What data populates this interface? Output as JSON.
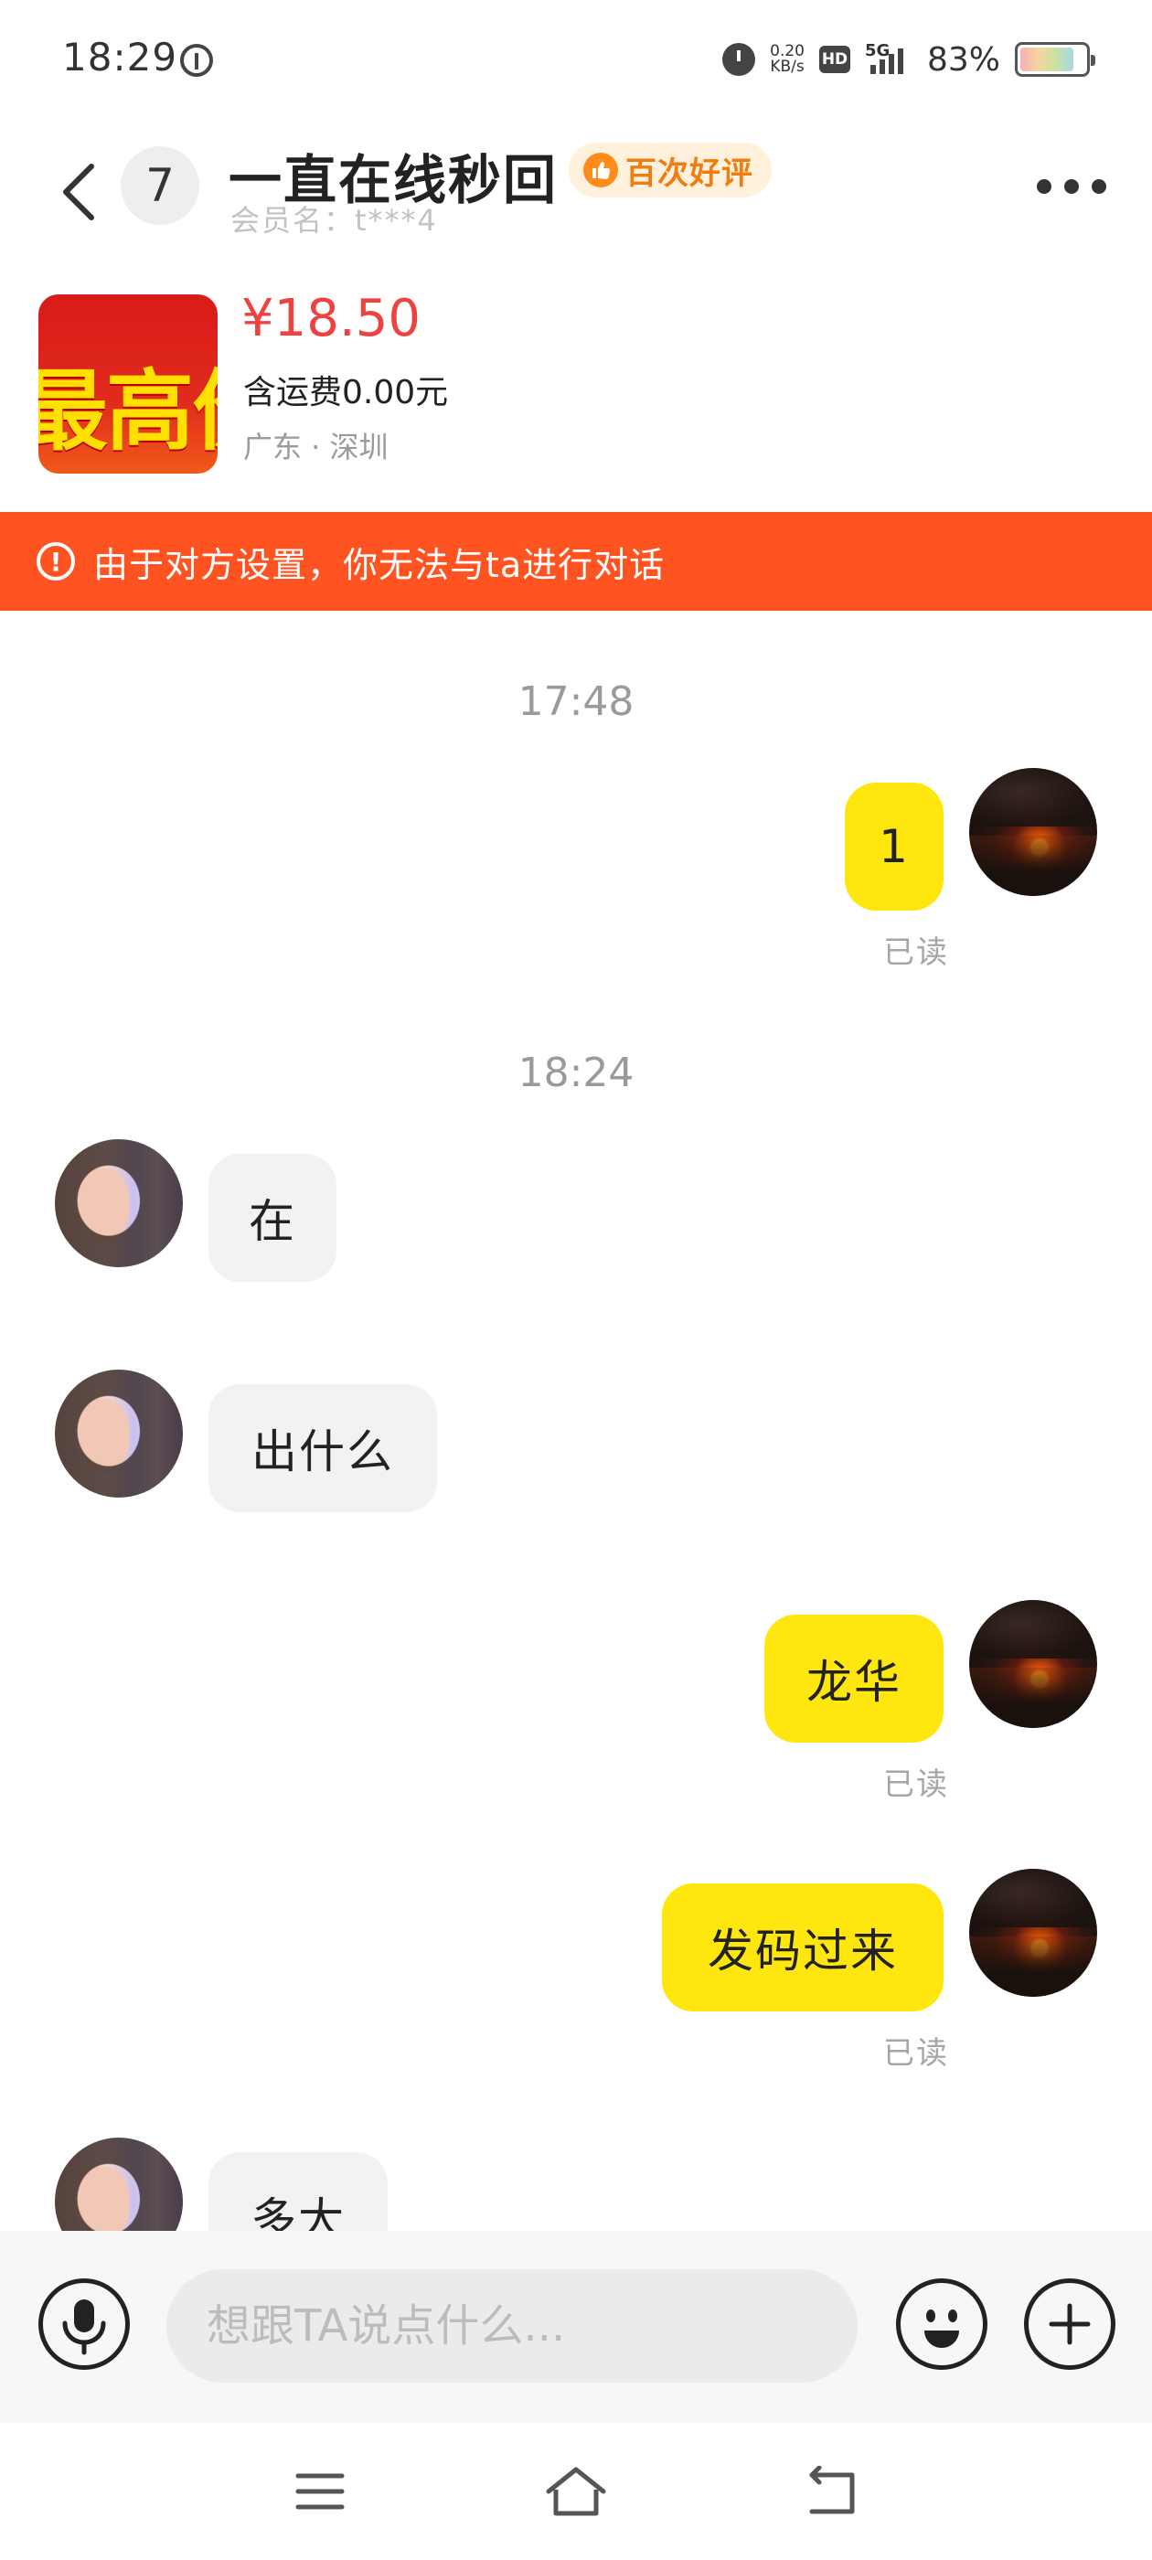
{
  "status_bar": {
    "time": "18:29",
    "net_speed_value": "0.20",
    "net_speed_unit": "KB/s",
    "hd_label": "HD",
    "network_type": "5G",
    "battery_percent": "83%",
    "battery_level": 0.83
  },
  "header": {
    "unread_count": "7",
    "shop_name": "一直在线秒回",
    "rating_badge": "百次好评",
    "member_name": "会员名：t***4"
  },
  "product": {
    "image_text": "最高价",
    "price": "¥18.50",
    "shipping": "含运费0.00元",
    "location": "广东 · 深圳"
  },
  "notice": {
    "icon": "!",
    "text": "由于对方设置，你无法与ta进行对话"
  },
  "chat": {
    "timestamps": [
      "17:48",
      "18:24"
    ],
    "messages": [
      {
        "sender": "me",
        "text": "1",
        "status": "已读"
      },
      {
        "sender": "them",
        "text": "在"
      },
      {
        "sender": "them",
        "text": "出什么"
      },
      {
        "sender": "me",
        "text": "龙华",
        "status": "已读"
      },
      {
        "sender": "me",
        "text": "发码过来",
        "status": "已读"
      },
      {
        "sender": "them",
        "text": "多大"
      }
    ]
  },
  "input": {
    "placeholder": "想跟TA说点什么..."
  },
  "colors": {
    "accent_orange": "#ff5422",
    "my_bubble": "#ffe60f",
    "price_red": "#f04141",
    "badge_orange": "#f07d10"
  },
  "icons": {
    "back": "chevron-left-icon",
    "more": "more-dots-icon",
    "notice": "alert-circle-icon",
    "voice": "microphone-icon",
    "emoji": "smile-icon",
    "plus": "plus-circle-icon",
    "nav_menu": "menu-icon",
    "nav_home": "home-icon",
    "nav_back": "return-icon"
  }
}
